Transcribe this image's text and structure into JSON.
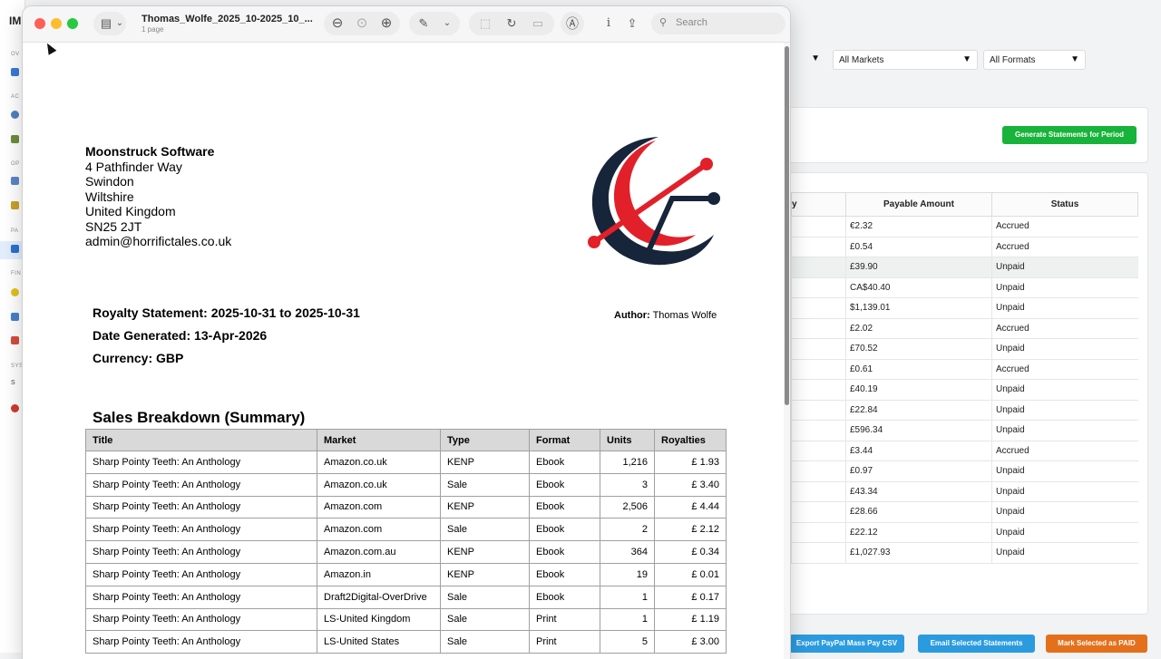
{
  "background_app": {
    "brand": "IM",
    "sidebar_sections": [
      "OV",
      "AC",
      "OP",
      "PA",
      "FIN",
      "SYS"
    ],
    "sidebar_item": "S",
    "filters": [
      {
        "label": "",
        "caret": "▼"
      },
      {
        "label": "All Markets",
        "caret": "▼"
      },
      {
        "label": "All Formats",
        "caret": "▼"
      }
    ],
    "generate_button": "Generate Statements for Period",
    "table_partial_header": "y",
    "table_headers": [
      "Payable Amount",
      "Status"
    ],
    "rows": [
      {
        "amount": "€2.32",
        "status": "Accrued"
      },
      {
        "amount": "£0.54",
        "status": "Accrued"
      },
      {
        "amount": "£39.90",
        "status": "Unpaid"
      },
      {
        "amount": "CA$40.40",
        "status": "Unpaid"
      },
      {
        "amount": "$1,139.01",
        "status": "Unpaid"
      },
      {
        "amount": "£2.02",
        "status": "Accrued"
      },
      {
        "amount": "£70.52",
        "status": "Unpaid"
      },
      {
        "amount": "£0.61",
        "status": "Accrued"
      },
      {
        "amount": "£40.19",
        "status": "Unpaid"
      },
      {
        "amount": "£22.84",
        "status": "Unpaid"
      },
      {
        "amount": "£596.34",
        "status": "Unpaid"
      },
      {
        "amount": "£3.44",
        "status": "Accrued"
      },
      {
        "amount": "£0.97",
        "status": "Unpaid"
      },
      {
        "amount": "£43.34",
        "status": "Unpaid"
      },
      {
        "amount": "£28.66",
        "status": "Unpaid"
      },
      {
        "amount": "£22.12",
        "status": "Unpaid"
      },
      {
        "amount": "£1,027.93",
        "status": "Unpaid"
      }
    ],
    "footer_buttons": {
      "export": "Export PayPal Mass Pay CSV",
      "email": "Email Selected Statements",
      "mark_paid": "Mark Selected as PAID"
    }
  },
  "preview": {
    "file_name": "Thomas_Wolfe_2025_10-2025_10_...",
    "page_count": "1 page",
    "search_placeholder": "Search",
    "toolbar_glyphs": {
      "sidebar": "▤",
      "chevron": "⌄",
      "zoom_out": "⊖",
      "zoom_fit": "⊙",
      "zoom_in": "⊕",
      "markup": "✎",
      "markup_menu": "⌄",
      "crop": "⬚",
      "rotate": "↻",
      "redact": "▭",
      "annotate": "Ⓐ",
      "info": "i",
      "share": "⇪",
      "search": "⚲"
    }
  },
  "statement": {
    "company": "Moonstruck Software",
    "address_lines": [
      "4 Pathfinder Way",
      "Swindon",
      "Wiltshire",
      "United Kingdom",
      "SN25 2JT",
      "admin@horrifictales.co.uk"
    ],
    "royalty_statement": "Royalty Statement: 2025-10-31 to 2025-10-31",
    "date_generated": "Date Generated: 13-Apr-2026",
    "currency": "Currency: GBP",
    "author_label": "Author:",
    "author_name": "Thomas Wolfe",
    "sales_title": "Sales Breakdown (Summary)",
    "sales_headers": [
      "Title",
      "Market",
      "Type",
      "Format",
      "Units",
      "Royalties"
    ],
    "sales_rows": [
      [
        "Sharp Pointy Teeth: An Anthology",
        "Amazon.co.uk",
        "KENP",
        "Ebook",
        "1,216",
        "£ 1.93"
      ],
      [
        "Sharp Pointy Teeth: An Anthology",
        "Amazon.co.uk",
        "Sale",
        "Ebook",
        "3",
        "£ 3.40"
      ],
      [
        "Sharp Pointy Teeth: An Anthology",
        "Amazon.com",
        "KENP",
        "Ebook",
        "2,506",
        "£ 4.44"
      ],
      [
        "Sharp Pointy Teeth: An Anthology",
        "Amazon.com",
        "Sale",
        "Ebook",
        "2",
        "£ 2.12"
      ],
      [
        "Sharp Pointy Teeth: An Anthology",
        "Amazon.com.au",
        "KENP",
        "Ebook",
        "364",
        "£ 0.34"
      ],
      [
        "Sharp Pointy Teeth: An Anthology",
        "Amazon.in",
        "KENP",
        "Ebook",
        "19",
        "£ 0.01"
      ],
      [
        "Sharp Pointy Teeth: An Anthology",
        "Draft2Digital-OverDrive",
        "Sale",
        "Ebook",
        "1",
        "£ 0.17"
      ],
      [
        "Sharp Pointy Teeth: An Anthology",
        "LS-United Kingdom",
        "Sale",
        "Print",
        "1",
        "£ 1.19"
      ],
      [
        "Sharp Pointy Teeth: An Anthology",
        "LS-United States",
        "Sale",
        "Print",
        "5",
        "£ 3.00"
      ]
    ]
  },
  "colors": {
    "green_button": "#18b33a",
    "blue_button": "#2b9bdf",
    "orange_button": "#e4701b",
    "logo_red": "#e2202a",
    "logo_navy": "#16253a"
  }
}
